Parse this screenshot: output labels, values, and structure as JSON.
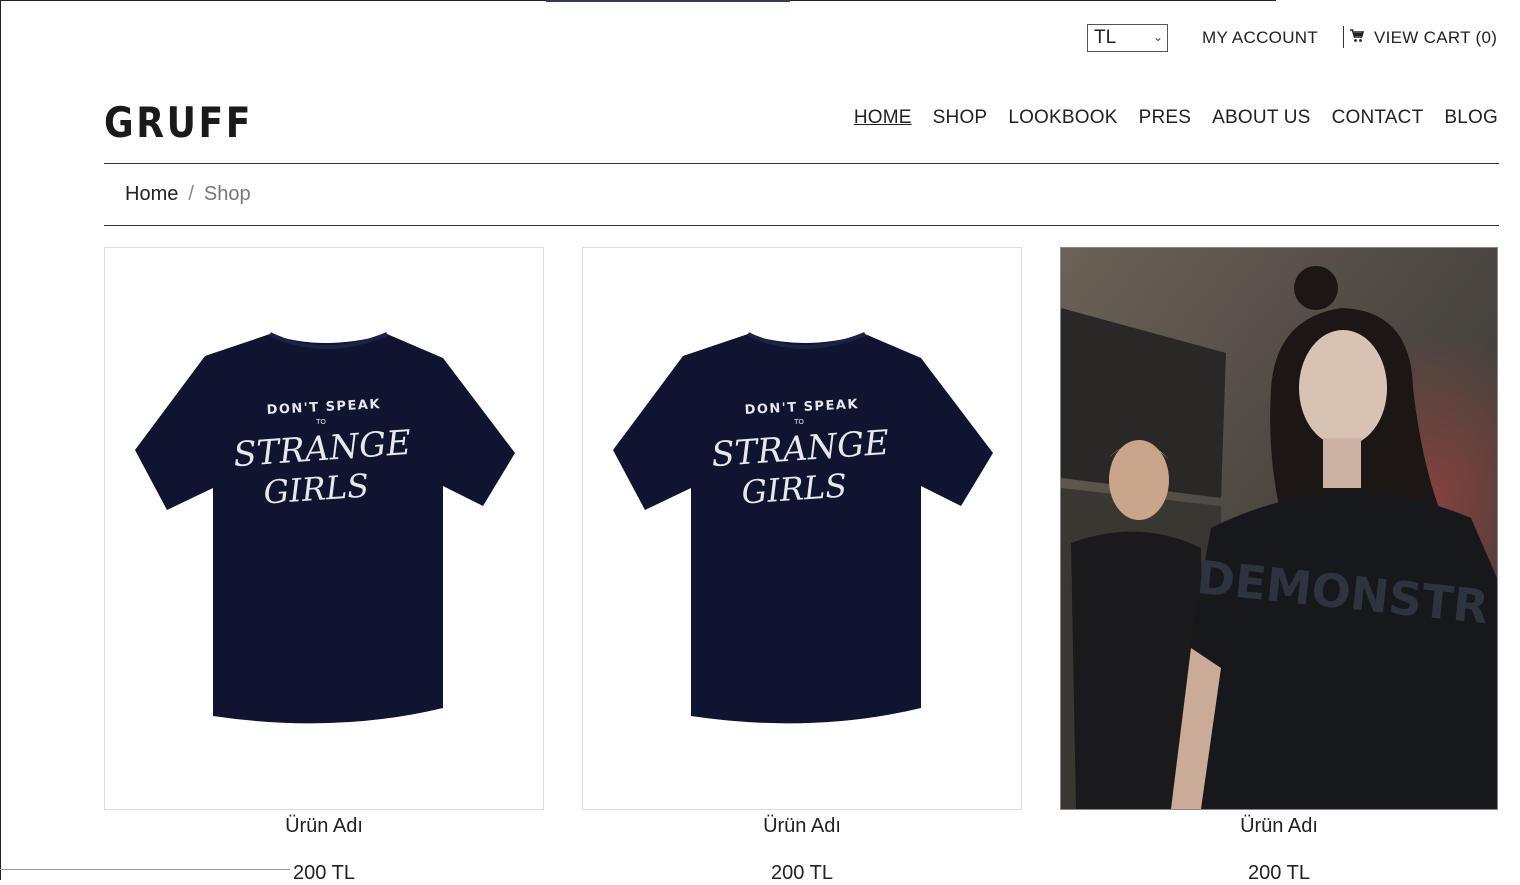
{
  "topbar": {
    "currency": "TL",
    "my_account": "MY ACCOUNT",
    "view_cart": "VIEW CART (0)"
  },
  "header": {
    "logo": "GRUFF",
    "nav": [
      "HOME",
      "SHOP",
      "LOOKBOOK",
      "PRES",
      "ABOUT US",
      "CONTACT",
      "BLOG"
    ],
    "active_nav": "HOME"
  },
  "breadcrumb": {
    "home": "Home",
    "separator": "/",
    "current": "Shop"
  },
  "tee_print": {
    "line1": "DON'T SPEAK",
    "line2": "TO",
    "line3": "STRANGE",
    "line4": "GIRLS"
  },
  "photo_print": "DEMONSTR",
  "products": [
    {
      "name": "Ürün Adı",
      "price": "200 TL",
      "image": "navy-tshirt-back"
    },
    {
      "name": "Ürün Adı",
      "price": "200 TL",
      "image": "navy-tshirt-back"
    },
    {
      "name": "Ürün Adı",
      "price": "200 TL",
      "image": "model-photo"
    }
  ],
  "colors": {
    "tee": "#0f1430",
    "print": "#e8e8e8",
    "text": "#222222"
  },
  "icons": {
    "cart": "cart-icon",
    "select": "chevron-down-icon"
  }
}
